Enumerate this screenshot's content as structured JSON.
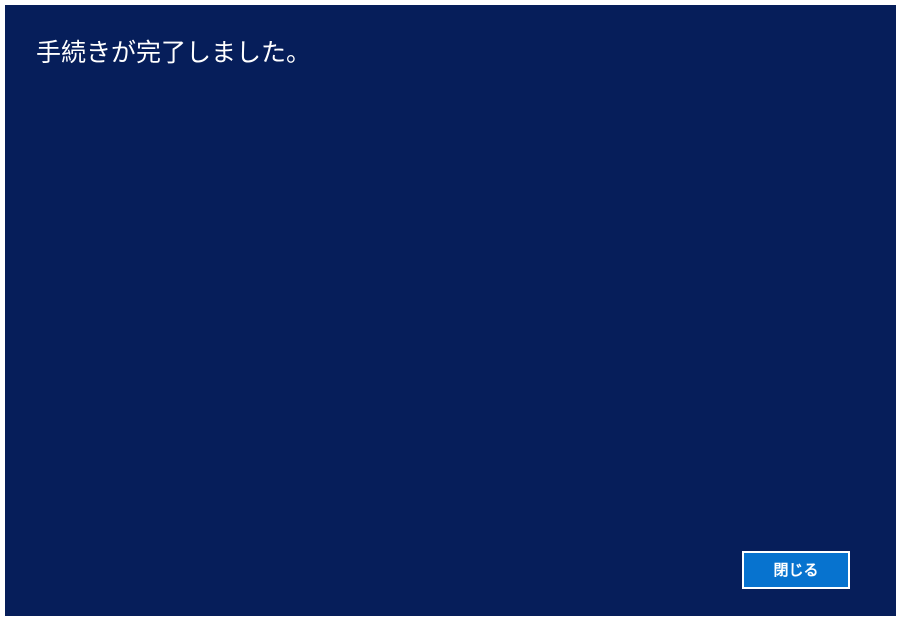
{
  "dialog": {
    "title": "手続きが完了しました。",
    "close_button_label": "閉じる"
  },
  "colors": {
    "background": "#061e5a",
    "button_background": "#0773cf",
    "button_border": "#ffffff",
    "text": "#ffffff"
  }
}
